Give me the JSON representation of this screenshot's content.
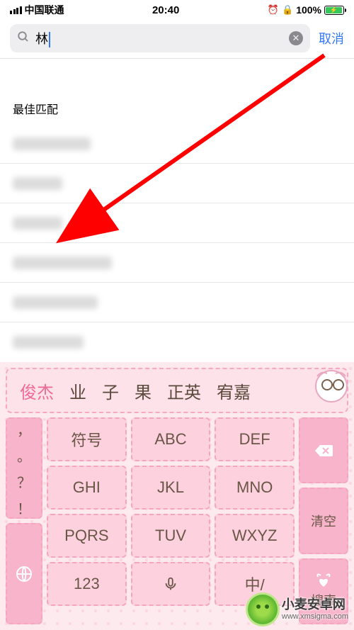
{
  "status": {
    "carrier": "中国联通",
    "time": "20:40",
    "battery_pct": "100%"
  },
  "search": {
    "query": "林",
    "cancel": "取消"
  },
  "results": {
    "section_title": "最佳匹配"
  },
  "keyboard": {
    "candidates": {
      "active": "俊杰",
      "c1": "业",
      "c2": "子",
      "c3": "果",
      "c4": "正英",
      "c5": "宥嘉"
    },
    "keys": {
      "symbol": "符号",
      "abc": "ABC",
      "def": "DEF",
      "ghi": "GHI",
      "jkl": "JKL",
      "mno": "MNO",
      "pqrs": "PQRS",
      "tuv": "TUV",
      "wxyz": "WXYZ",
      "num": "123",
      "lang": "中/",
      "clear": "清空",
      "search": "搜索",
      "comma": "，",
      "period": "。",
      "question": "？",
      "exclaim": "！"
    }
  },
  "watermark": {
    "brand": "小麦安卓网",
    "url": "www.xmsigma.com"
  }
}
